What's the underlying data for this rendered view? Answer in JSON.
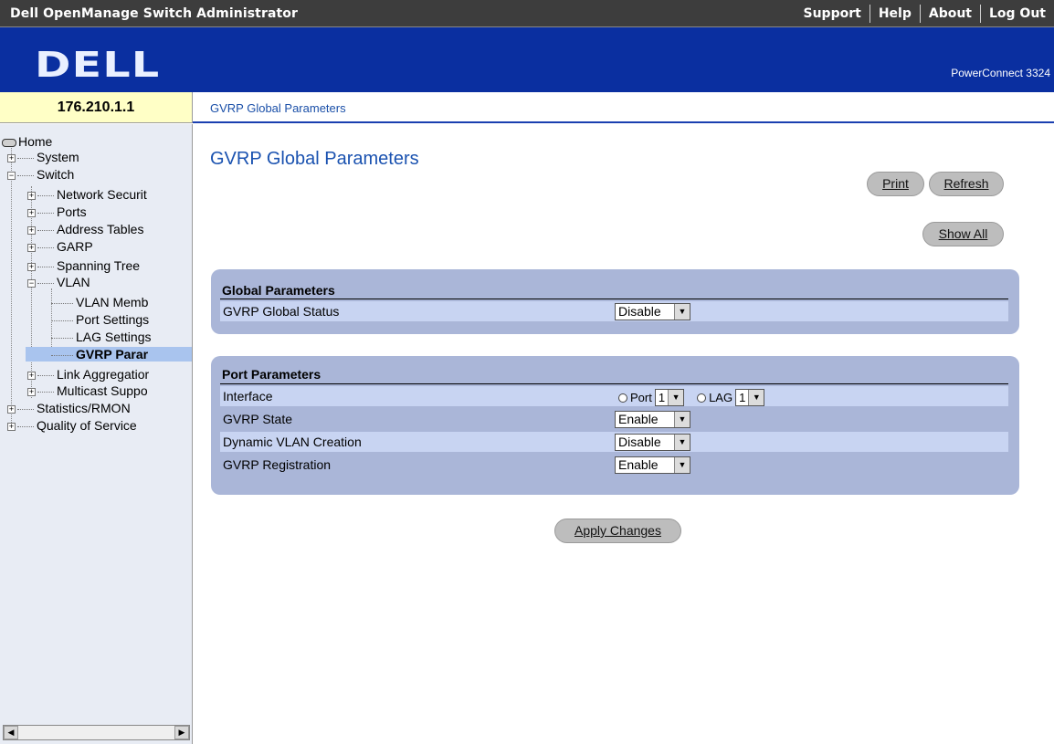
{
  "app": {
    "title": "Dell OpenManage Switch Administrator",
    "product": "PowerConnect 3324",
    "logo": "DELL"
  },
  "topnav": {
    "support": "Support",
    "help": "Help",
    "about": "About",
    "logout": "Log Out"
  },
  "ip": "176.210.1.1",
  "breadcrumb": "GVRP Global Parameters",
  "tree": {
    "home": "Home",
    "system": "System",
    "switch": "Switch",
    "network_security": "Network Securit",
    "ports": "Ports",
    "address_tables": "Address Tables",
    "garp": "GARP",
    "spanning_tree": "Spanning Tree",
    "vlan": "VLAN",
    "vlan_membership": "VLAN Memb",
    "port_settings": "Port Settings",
    "lag_settings": "LAG Settings",
    "gvrp_parameters": "GVRP Parar",
    "link_aggregation": "Link Aggregatior",
    "multicast_support": "Multicast Suppo",
    "statistics_rmon": "Statistics/RMON",
    "qos": "Quality of Service"
  },
  "page": {
    "title": "GVRP Global Parameters",
    "print": "Print",
    "refresh": "Refresh",
    "show_all": "Show All",
    "apply": "Apply Changes"
  },
  "global_params": {
    "header": "Global Parameters",
    "status_label": "GVRP Global Status",
    "status_value": "Disable"
  },
  "port_params": {
    "header": "Port Parameters",
    "interface_label": "Interface",
    "port_label": "Port",
    "port_value": "1",
    "lag_label": "LAG",
    "lag_value": "1",
    "state_label": "GVRP State",
    "state_value": "Enable",
    "dynamic_label": "Dynamic VLAN Creation",
    "dynamic_value": "Disable",
    "registration_label": "GVRP Registration",
    "registration_value": "Enable"
  },
  "colors": {
    "banner": "#0a2fa0",
    "panel": "#aab6d8",
    "title": "#1a52b0"
  }
}
